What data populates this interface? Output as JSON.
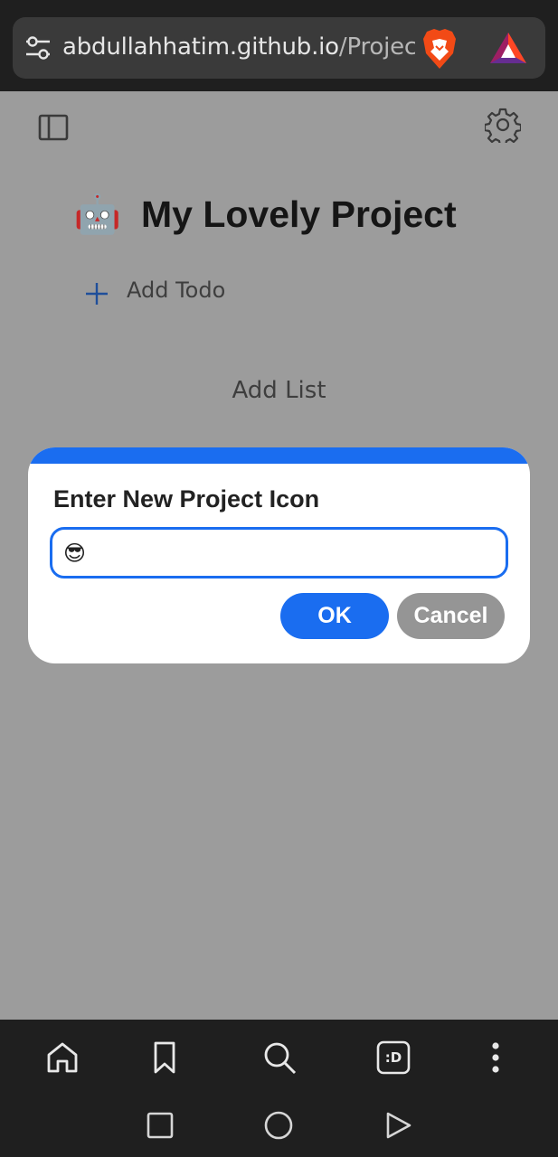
{
  "browser": {
    "url_domain": "abdullahhatim.github.io",
    "url_path": "/Projec",
    "icons": [
      "site-settings-icon",
      "brave-shield-icon",
      "bat-rewards-icon"
    ]
  },
  "page": {
    "project_icon": "🤖",
    "project_title": "My Lovely Project",
    "add_todo_label": "Add Todo",
    "add_list_label": "Add List"
  },
  "modal": {
    "title": "Enter New Project Icon",
    "input_value": "😎",
    "ok_label": "OK",
    "cancel_label": "Cancel"
  },
  "toolbar": {
    "icons": [
      "home-icon",
      "bookmark-icon",
      "search-icon",
      "tab-switcher-icon",
      "more-menu-icon"
    ],
    "tab_badge": ":D"
  },
  "system_nav": {
    "icons": [
      "recents-icon",
      "home-circle-icon",
      "back-icon"
    ]
  },
  "colors": {
    "accent": "#1a6df0",
    "overlay_bg": "#9c9c9c",
    "browser_chrome": "#1f1f1f"
  }
}
